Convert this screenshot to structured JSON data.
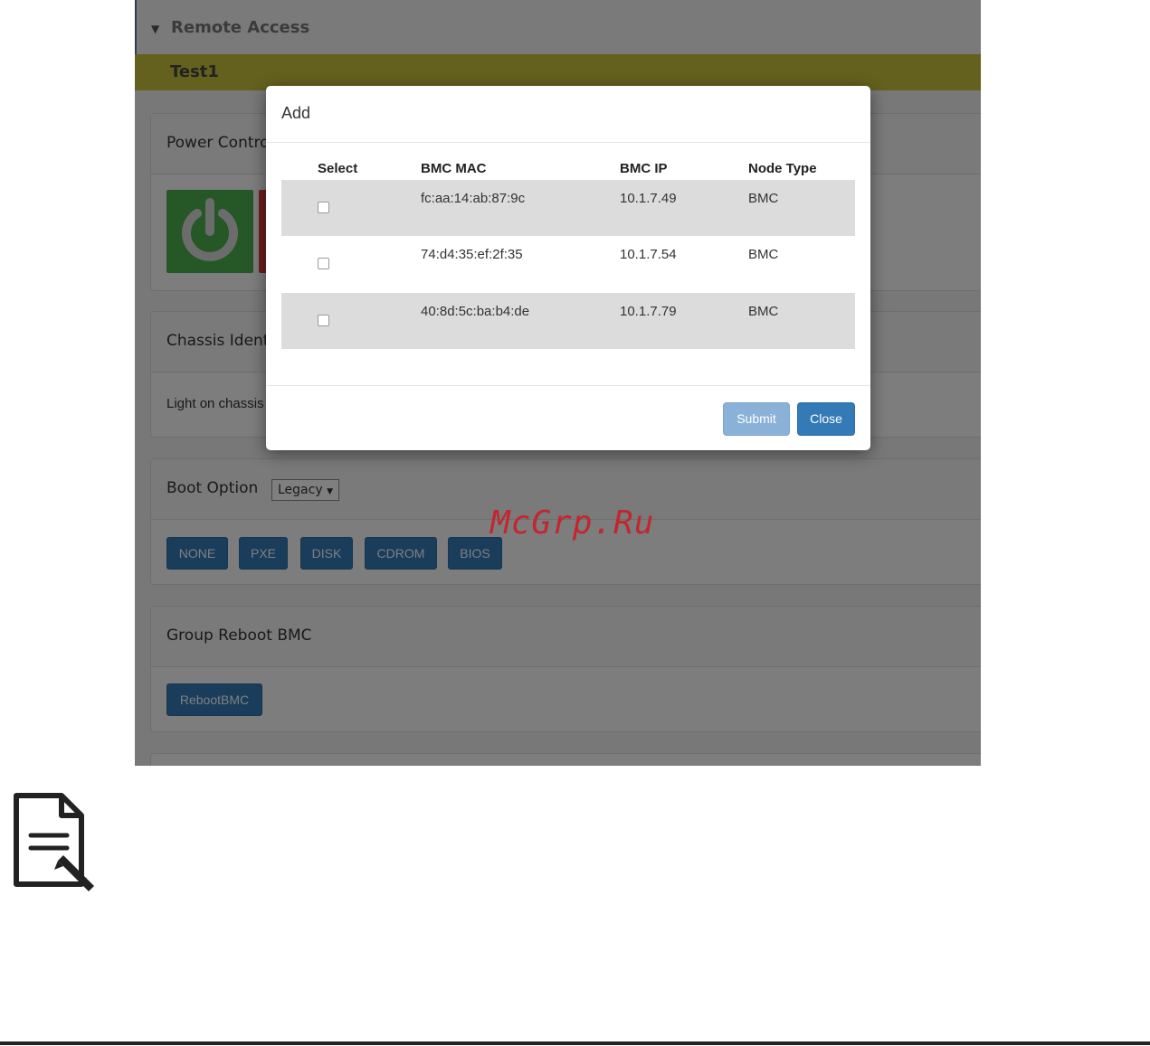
{
  "app": {
    "section_title": "Remote Access",
    "group_name": "Test1"
  },
  "panels": {
    "power": {
      "title": "Power Control"
    },
    "chassis": {
      "title": "Chassis Identify",
      "text": "Light on chassis"
    },
    "boot": {
      "title": "Boot Option",
      "selected": "Legacy",
      "buttons": [
        "NONE",
        "PXE",
        "DISK",
        "CDROM",
        "BIOS"
      ]
    },
    "reboot": {
      "title": "Group Reboot BMC",
      "button": "RebootBMC"
    }
  },
  "modal": {
    "title": "Add",
    "columns": [
      "Select",
      "BMC MAC",
      "BMC IP",
      "Node Type"
    ],
    "rows": [
      {
        "mac": "fc:aa:14:ab:87:9c",
        "ip": "10.1.7.49",
        "type": "BMC"
      },
      {
        "mac": "74:d4:35:ef:2f:35",
        "ip": "10.1.7.54",
        "type": "BMC"
      },
      {
        "mac": "40:8d:5c:ba:b4:de",
        "ip": "10.1.7.79",
        "type": "BMC"
      }
    ],
    "submit": "Submit",
    "close": "Close"
  },
  "watermark": "McGrp.Ru",
  "colors": {
    "accent": "#337ab7",
    "group_bar": "#c9c23c",
    "power_green": "#4cae4c",
    "power_red": "#d43f3a",
    "watermark": "#c2262e"
  },
  "icons": [
    "power-icon",
    "chevron-down-icon",
    "note-icon"
  ]
}
